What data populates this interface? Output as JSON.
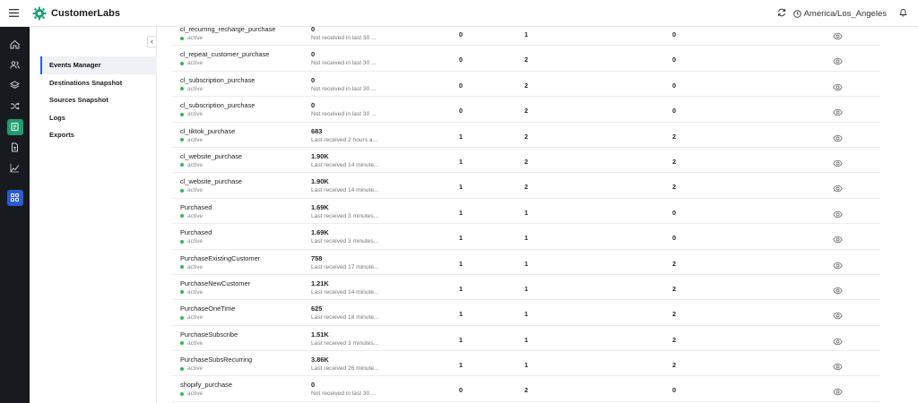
{
  "app": {
    "brand": "CustomerLabs",
    "timezone": "America/Los_Angeles"
  },
  "colors": {
    "rail_bg": "#171b1f",
    "accent_green": "#1f9d6f",
    "accent_blue": "#2d5bd6",
    "active_dot": "#2fb84f"
  },
  "rail": {
    "items": [
      {
        "icon": "home-icon"
      },
      {
        "icon": "users-icon"
      },
      {
        "icon": "layers-icon"
      },
      {
        "icon": "shuffle-icon"
      },
      {
        "icon": "events-icon",
        "active": true
      },
      {
        "icon": "document-icon"
      },
      {
        "icon": "chart-icon"
      },
      {
        "icon": "apps-grid-icon"
      }
    ]
  },
  "subnav": {
    "items": [
      {
        "label": "Events Manager",
        "active": true
      },
      {
        "label": "Destinations Snapshot"
      },
      {
        "label": "Sources Snapshot"
      },
      {
        "label": "Logs"
      },
      {
        "label": "Exports"
      }
    ]
  },
  "events": [
    {
      "name": "cl_recurring_recharge_purchase",
      "status": "active",
      "count": "0",
      "last": "Not received in last 30 ...",
      "a": "0",
      "b": "1",
      "c": "0"
    },
    {
      "name": "cl_repeat_customer_purchase",
      "status": "active",
      "count": "0",
      "last": "Not received in last 30 ...",
      "a": "0",
      "b": "2",
      "c": "0"
    },
    {
      "name": "cl_subscription_purchase",
      "status": "active",
      "count": "0",
      "last": "Not received in last 30 ...",
      "a": "0",
      "b": "2",
      "c": "0"
    },
    {
      "name": "cl_subscription_purchase",
      "status": "active",
      "count": "0",
      "last": "Not received in last 30 ...",
      "a": "0",
      "b": "2",
      "c": "0"
    },
    {
      "name": "cl_tiktok_purchase",
      "status": "active",
      "count": "683",
      "last": "Last received 2 hours a...",
      "a": "1",
      "b": "2",
      "c": "2"
    },
    {
      "name": "cl_website_purchase",
      "status": "active",
      "count": "1.90K",
      "last": "Last received 14 minute...",
      "a": "1",
      "b": "2",
      "c": "2"
    },
    {
      "name": "cl_website_purchase",
      "status": "active",
      "count": "1.90K",
      "last": "Last received 14 minute...",
      "a": "1",
      "b": "2",
      "c": "2"
    },
    {
      "name": "Purchased",
      "status": "active",
      "count": "1.69K",
      "last": "Last received 3 minutes...",
      "a": "1",
      "b": "1",
      "c": "0"
    },
    {
      "name": "Purchased",
      "status": "active",
      "count": "1.69K",
      "last": "Last received 3 minutes...",
      "a": "1",
      "b": "1",
      "c": "0"
    },
    {
      "name": "PurchaseExistingCustomer",
      "status": "active",
      "count": "758",
      "last": "Last received 17 minute...",
      "a": "1",
      "b": "1",
      "c": "2"
    },
    {
      "name": "PurchaseNewCustomer",
      "status": "active",
      "count": "1.21K",
      "last": "Last received 14 minute...",
      "a": "1",
      "b": "1",
      "c": "2"
    },
    {
      "name": "PurchaseOneTime",
      "status": "active",
      "count": "625",
      "last": "Last received 18 minute...",
      "a": "1",
      "b": "1",
      "c": "2"
    },
    {
      "name": "PurchaseSubscribe",
      "status": "active",
      "count": "1.51K",
      "last": "Last received 3 minutes...",
      "a": "1",
      "b": "1",
      "c": "2"
    },
    {
      "name": "PurchaseSubsRecurring",
      "status": "active",
      "count": "3.86K",
      "last": "Last received 26 minute...",
      "a": "1",
      "b": "1",
      "c": "2"
    },
    {
      "name": "shopify_purchase",
      "status": "active",
      "count": "0",
      "last": "Not received in last 30 ...",
      "a": "0",
      "b": "2",
      "c": "0"
    }
  ]
}
